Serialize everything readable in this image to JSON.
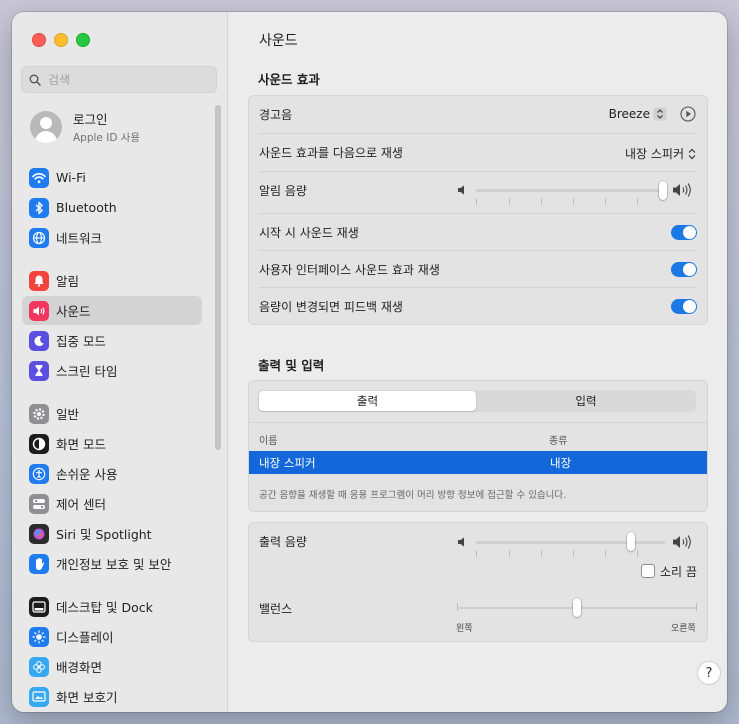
{
  "sidebar": {
    "search_placeholder": "검색",
    "account": {
      "title": "로그인",
      "subtitle": "Apple ID 사용"
    },
    "items": [
      {
        "label": "Wi-Fi",
        "icon": "wifi-icon",
        "color": "#1f7cf0"
      },
      {
        "label": "Bluetooth",
        "icon": "bluetooth-icon",
        "color": "#1f7cf0"
      },
      {
        "label": "네트워크",
        "icon": "globe-icon",
        "color": "#1f7cf0"
      },
      {
        "label": "알림",
        "icon": "bell-icon",
        "color": "#f4433c"
      },
      {
        "label": "사운드",
        "icon": "speaker-icon",
        "color": "#f2355f",
        "active": true
      },
      {
        "label": "집중 모드",
        "icon": "moon-icon",
        "color": "#5b4fe0"
      },
      {
        "label": "스크린 타임",
        "icon": "hourglass-icon",
        "color": "#5b4fe0"
      },
      {
        "label": "일반",
        "icon": "gear-icon",
        "color": "#8e8e93"
      },
      {
        "label": "화면 모드",
        "icon": "appearance-icon",
        "color": "#1c1c1c"
      },
      {
        "label": "손쉬운 사용",
        "icon": "accessibility-icon",
        "color": "#1f7cf0"
      },
      {
        "label": "제어 센터",
        "icon": "control-center-icon",
        "color": "#8e8e93"
      },
      {
        "label": "Siri 및 Spotlight",
        "icon": "siri-icon",
        "color": "#2b2b2b"
      },
      {
        "label": "개인정보 보호 및 보안",
        "icon": "hand-icon",
        "color": "#1f7cf0"
      },
      {
        "label": "데스크탑 및 Dock",
        "icon": "dock-icon",
        "color": "#1c1c1c"
      },
      {
        "label": "디스플레이",
        "icon": "sun-icon",
        "color": "#1f7cf0"
      },
      {
        "label": "배경화면",
        "icon": "flower-icon",
        "color": "#36a9f0"
      },
      {
        "label": "화면 보호기",
        "icon": "screensaver-icon",
        "color": "#36a9f0"
      }
    ]
  },
  "main": {
    "title": "사운드",
    "effects": {
      "title": "사운드 효과",
      "alert_sound_label": "경고음",
      "alert_sound_value": "Breeze",
      "play_via_label": "사운드 효과를 다음으로 재생",
      "play_via_value": "내장 스피커",
      "alert_volume_label": "알림 음량",
      "alert_volume_level": 1.0,
      "startup_label": "시작 시 사운드 재생",
      "startup_on": true,
      "ui_sounds_label": "사용자 인터페이스 사운드 효과 재생",
      "ui_sounds_on": true,
      "feedback_label": "음량이 변경되면 피드백 재생",
      "feedback_on": true
    },
    "output_input": {
      "title": "출력 및 입력",
      "tab_output": "출력",
      "tab_input": "입력",
      "col_name": "이름",
      "col_type": "종류",
      "rows": [
        {
          "name": "내장 스피커",
          "type": "내장"
        }
      ],
      "note": "공간 음향을 재생할 때 응용 프로그램이 머리 방향 정보에 접근할 수 있습니다."
    },
    "output_volume": {
      "label": "출력 음량",
      "level": 0.73,
      "mute_label": "소리 끔",
      "balance_label": "밸런스",
      "balance_left": "왼쪽",
      "balance_right": "오른쪽",
      "balance": 0.5
    },
    "help": "?"
  },
  "colors": {
    "accent": "#1a79e5",
    "selection": "#1467d9"
  }
}
